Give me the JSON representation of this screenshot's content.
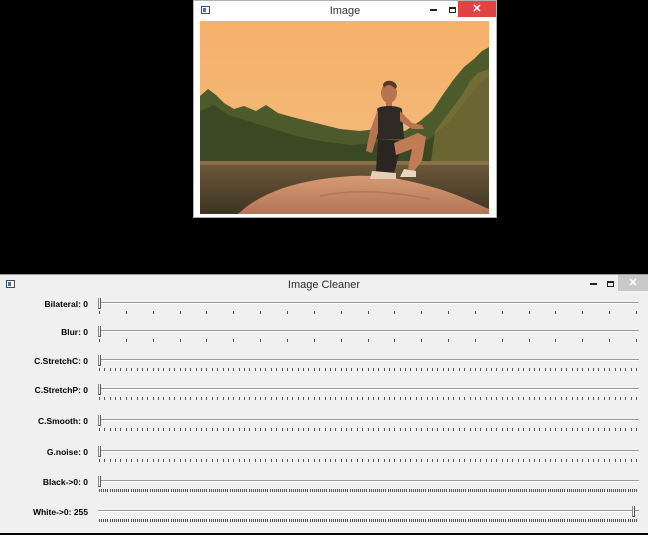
{
  "image_window": {
    "title": "Image"
  },
  "cleaner_window": {
    "title": "Image Cleaner",
    "trackbars": [
      {
        "id": "bilateral",
        "label": "Bilateral: 0",
        "value": 0,
        "max": 20,
        "position": 0.0
      },
      {
        "id": "blur",
        "label": "Blur: 0",
        "value": 0,
        "max": 20,
        "position": 0.0
      },
      {
        "id": "cstretchc",
        "label": "C.StretchC: 0",
        "value": 0,
        "max": 100,
        "position": 0.0
      },
      {
        "id": "cstretchp",
        "label": "C.StretchP: 0",
        "value": 0,
        "max": 100,
        "position": 0.0
      },
      {
        "id": "csmooth",
        "label": "C.Smooth: 0",
        "value": 0,
        "max": 100,
        "position": 0.0
      },
      {
        "id": "gnoise",
        "label": "G.noise: 0",
        "value": 0,
        "max": 100,
        "position": 0.0
      },
      {
        "id": "black0",
        "label": "Black->0: 0",
        "value": 0,
        "max": 255,
        "position": 0.0
      },
      {
        "id": "white0",
        "label": "White->0: 255",
        "value": 255,
        "max": 255,
        "position": 1.0
      }
    ]
  },
  "colors": {
    "close_button": "#e04343",
    "sky": "#f4b872",
    "window_bg": "#f0f0f0"
  },
  "icons": [
    "app-icon",
    "minimize-icon",
    "maximize-icon",
    "close-icon"
  ]
}
